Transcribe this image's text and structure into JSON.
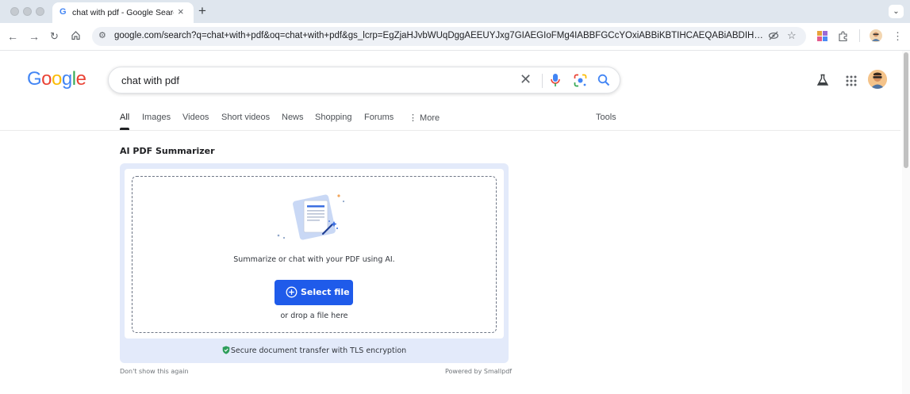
{
  "browser": {
    "tab_title": "chat with pdf - Google Search",
    "favicon_letter": "G",
    "url": "google.com/search?q=chat+with+pdf&oq=chat+with+pdf&gs_lcrp=EgZjaHJvbWUqDggAEEUYJxg7GIAEGIoFMg4IABBFGCcYOxiABBiKBTIHCAEQABiABDIHCAIQABi..."
  },
  "google": {
    "logo_letters": [
      "G",
      "o",
      "o",
      "g",
      "l",
      "e"
    ],
    "logo_colors": [
      "#4285f4",
      "#ea4335",
      "#fbbc05",
      "#4285f4",
      "#34a853",
      "#ea4335"
    ],
    "query": "chat with pdf",
    "tabs": [
      {
        "label": "All",
        "active": true
      },
      {
        "label": "Images"
      },
      {
        "label": "Videos"
      },
      {
        "label": "Short videos"
      },
      {
        "label": "News"
      },
      {
        "label": "Shopping"
      },
      {
        "label": "Forums"
      },
      {
        "label": "⋮ More"
      }
    ],
    "tools_label": "Tools"
  },
  "card": {
    "title": "AI PDF Summarizer",
    "caption": "Summarize or chat with your PDF using AI.",
    "select_label": "Select file",
    "drop_hint": "or drop a file here",
    "secure_text": "Secure document transfer with TLS encryption",
    "dont_show": "Don't show this again",
    "powered_by": "Powered by Smallpdf",
    "accent_color": "#1f5bea",
    "background_color": "#e3eafa"
  }
}
